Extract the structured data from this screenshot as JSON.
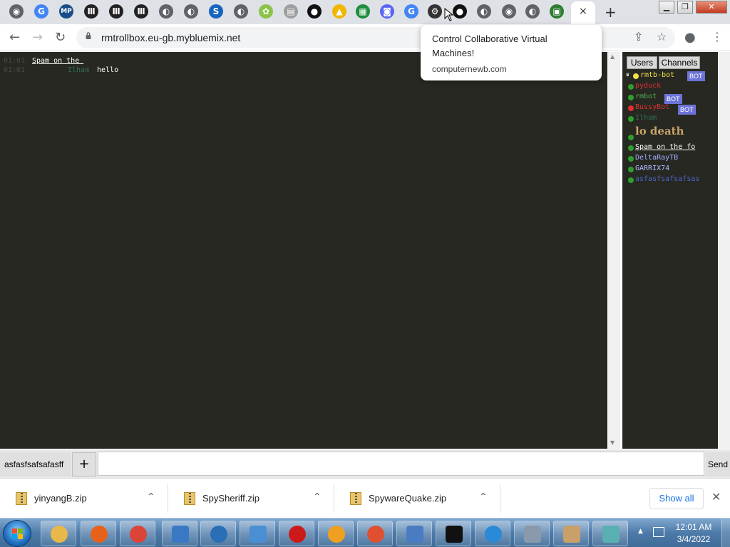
{
  "browser": {
    "tabs": [
      {
        "icon": "chrome-icon",
        "color": "#5f6368",
        "glyph": "◉"
      },
      {
        "icon": "google-icon",
        "color": "#4285f4",
        "glyph": "G"
      },
      {
        "icon": "mp-icon",
        "color": "#1a4e8a",
        "glyph": "MP"
      },
      {
        "icon": "archive-icon",
        "color": "#222222",
        "glyph": "Ⅲ"
      },
      {
        "icon": "archive-icon",
        "color": "#222222",
        "glyph": "Ⅲ"
      },
      {
        "icon": "archive-icon",
        "color": "#222222",
        "glyph": "Ⅲ"
      },
      {
        "icon": "globe-icon",
        "color": "#5f6368",
        "glyph": "◐"
      },
      {
        "icon": "globe-icon",
        "color": "#5f6368",
        "glyph": "◐"
      },
      {
        "icon": "s-logo-icon",
        "color": "#1565c0",
        "glyph": "S"
      },
      {
        "icon": "globe-icon",
        "color": "#5f6368",
        "glyph": "◐"
      },
      {
        "icon": "nature-icon",
        "color": "#8bc34a",
        "glyph": "✿"
      },
      {
        "icon": "document-icon",
        "color": "#9e9e9e",
        "glyph": "▤"
      },
      {
        "icon": "github-icon",
        "color": "#111111",
        "glyph": "●"
      },
      {
        "icon": "warning-icon",
        "color": "#f2b600",
        "glyph": "▲"
      },
      {
        "icon": "spreadsheet-icon",
        "color": "#1e8e3e",
        "glyph": "▦"
      },
      {
        "icon": "discord-icon",
        "color": "#5865f2",
        "glyph": "◙"
      },
      {
        "icon": "google-icon",
        "color": "#4285f4",
        "glyph": "G"
      },
      {
        "icon": "game-icon",
        "color": "#333333",
        "glyph": "⚙"
      },
      {
        "icon": "github-icon",
        "color": "#111111",
        "glyph": "●"
      },
      {
        "icon": "globe-icon",
        "color": "#5f6368",
        "glyph": "◐"
      },
      {
        "icon": "chrome-icon",
        "color": "#5f6368",
        "glyph": "◉"
      },
      {
        "icon": "globe-icon",
        "color": "#5f6368",
        "glyph": "◐"
      },
      {
        "icon": "pixel-icon",
        "color": "#2e7d32",
        "glyph": "▣"
      }
    ],
    "active_tab_close": "×",
    "new_tab": "+",
    "url": "rmtrollbox.eu-gb.mybluemix.net",
    "tooltip": {
      "title": "Control Collaborative Virtual Machines!",
      "domain": "computernewb.com"
    }
  },
  "chat": {
    "messages": [
      {
        "time": "01:01",
        "nick": "Spam on the ",
        "nick_color": "#ffffff",
        "underline": true,
        "text": ""
      },
      {
        "time": "01:01",
        "nick": "Ilham",
        "nick_color": "#2f6e55",
        "underline": false,
        "text": "hello"
      }
    ]
  },
  "panel": {
    "tabs": {
      "users": "Users",
      "channels": "Channels"
    },
    "users": [
      {
        "name": "rmtb-bot",
        "color": "#f5e04a",
        "dot": "#f5e04a",
        "bot": true,
        "crown": true
      },
      {
        "name": "pyduck",
        "color": "#e03030",
        "dot": "#2e9e2e",
        "bot": false
      },
      {
        "name": "rmbot",
        "color": "#4caf50",
        "dot": "#2e9e2e",
        "bot": true
      },
      {
        "name": "BussyBot",
        "color": "#e03030",
        "dot": "#e03030",
        "bot": true
      },
      {
        "name": "Ilham",
        "color": "#2f6e55",
        "dot": "#2e9e2e",
        "bot": false
      },
      {
        "name": "lo death",
        "color": "#c8a36a",
        "dot": "#2e9e2e",
        "bot": false,
        "big": true
      },
      {
        "name": "Spam on the fo",
        "color": "#ffffff",
        "dot": "#2e9e2e",
        "bot": false,
        "underline": true
      },
      {
        "name": "DeltaRayTB",
        "color": "#9fb0ff",
        "dot": "#2e9e2e",
        "bot": false
      },
      {
        "name": "GARRIX74",
        "color": "#b0b8ff",
        "dot": "#2e9e2e",
        "bot": false
      },
      {
        "name": "asfasfsafsafsas",
        "color": "#4a66c8",
        "dot": "#2e9e2e",
        "bot": false
      }
    ],
    "bot_label": "BOT"
  },
  "input": {
    "channel": "asfasfsafsafasff",
    "add": "+",
    "send": "Send"
  },
  "downloads": {
    "items": [
      {
        "name": "yinyangB.zip"
      },
      {
        "name": "SpySheriff.zip"
      },
      {
        "name": "SpywareQuake.zip"
      }
    ],
    "show_all": "Show all"
  },
  "taskbar": {
    "apps": [
      {
        "icon": "file-explorer-icon",
        "color": "#e8b84a"
      },
      {
        "icon": "firefox-icon",
        "color": "#e8611a"
      },
      {
        "icon": "chrome-icon",
        "color": "#db4437"
      },
      {
        "icon": "remote-desktop-icon",
        "color": "#3b78c4"
      },
      {
        "icon": "network-globe-icon",
        "color": "#2a6fb5"
      },
      {
        "icon": "security-shield-icon",
        "color": "#4a8fd4"
      },
      {
        "icon": "opera-icon",
        "color": "#cc1a1a"
      },
      {
        "icon": "vpn-lock-icon",
        "color": "#f0a020"
      },
      {
        "icon": "antivirus-icon",
        "color": "#e05030"
      },
      {
        "icon": "system-monitor-icon",
        "color": "#4a7cc4"
      },
      {
        "icon": "command-prompt-icon",
        "color": "#111111"
      },
      {
        "icon": "internet-explorer-icon",
        "color": "#2a8ad8"
      },
      {
        "icon": "calculator-icon",
        "color": "#8a9aaa"
      },
      {
        "icon": "paint-icon",
        "color": "#c9a06a"
      },
      {
        "icon": "cube-app-icon",
        "color": "#5ab0b0"
      }
    ],
    "time": "12:01 AM",
    "date": "3/4/2022"
  }
}
